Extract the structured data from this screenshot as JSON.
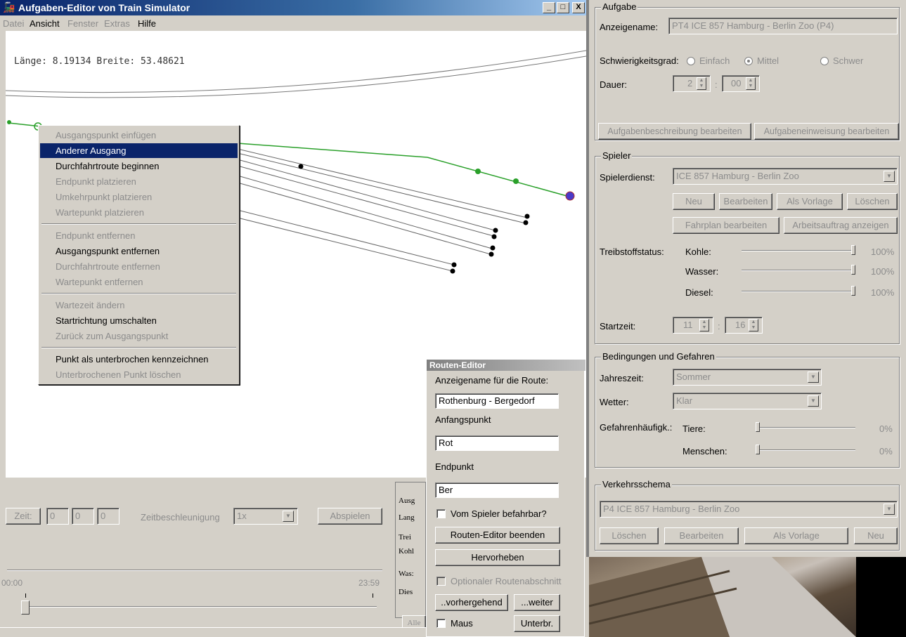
{
  "window": {
    "title": "Aufgaben-Editor von Train Simulator",
    "min": "_",
    "max": "□",
    "close": "X"
  },
  "menu": {
    "items": [
      {
        "label": "Datei",
        "enabled": false
      },
      {
        "label": "Ansicht",
        "enabled": true
      },
      {
        "label": "Fenster",
        "enabled": false
      },
      {
        "label": "Extras",
        "enabled": false
      },
      {
        "label": "Hilfe",
        "enabled": true
      }
    ]
  },
  "map": {
    "coords": "Länge: 8.19134 Breite: 53.48621"
  },
  "context_menu": {
    "items": [
      {
        "label": "Ausgangspunkt einfügen",
        "enabled": false
      },
      {
        "label": "Anderer Ausgang",
        "enabled": true,
        "selected": true
      },
      {
        "label": "Durchfahrtroute beginnen",
        "enabled": true
      },
      {
        "label": "Endpunkt platzieren",
        "enabled": false
      },
      {
        "label": "Umkehrpunkt platzieren",
        "enabled": false
      },
      {
        "label": "Wartepunkt platzieren",
        "enabled": false
      },
      {
        "label": "Endpunkt entfernen",
        "enabled": false
      },
      {
        "label": "Ausgangspunkt entfernen",
        "enabled": true
      },
      {
        "label": "Durchfahrtroute entfernen",
        "enabled": false
      },
      {
        "label": "Wartepunkt entfernen",
        "enabled": false
      },
      {
        "label": "Wartezeit ändern",
        "enabled": false
      },
      {
        "label": "Startrichtung umschalten",
        "enabled": true
      },
      {
        "label": "Zurück zum Ausgangspunkt",
        "enabled": false
      },
      {
        "label": "Punkt als unterbrochen kennzeichnen",
        "enabled": true
      },
      {
        "label": "Unterbrochenen Punkt löschen",
        "enabled": false
      }
    ]
  },
  "time_panel": {
    "zeit_button": "Zeit:",
    "h": "0",
    "m": "0",
    "s": "0",
    "accel_label": "Zeitbeschleunigung",
    "accel_value": "1x",
    "play_button": "Abspielen",
    "start": "00:00",
    "end": "23:59",
    "slider_value": 0
  },
  "mini_panel": {
    "rows": [
      "Ausg",
      "Lang",
      "Trei",
      "Kohl",
      "Was:",
      "Dies"
    ],
    "button": "Alle"
  },
  "route_editor": {
    "title": "Routen-Editor",
    "name_label": "Anzeigename für die Route:",
    "name_value": "Rothenburg - Bergedorf",
    "start_label": "Anfangspunkt",
    "start_value": "Rot",
    "end_label": "Endpunkt",
    "end_value": "Ber",
    "player_check": "Vom Spieler befahrbar?",
    "close_button": "Routen-Editor beenden",
    "highlight_button": "Hervorheben",
    "optional_check": "Optionaler Routenabschnitt",
    "prev_button": "..vorhergehend",
    "next_button": "...weiter",
    "mouse_check": "Maus",
    "break_button": "Unterbr."
  },
  "aufgabe": {
    "group": "Aufgabe",
    "name_label": "Anzeigename:",
    "name_value": "PT4 ICE 857 Hamburg - Berlin Zoo (P4)",
    "difficulty_label": "Schwierigkeitsgrad:",
    "easy": "Einfach",
    "medium": "Mittel",
    "hard": "Schwer",
    "duration_label": "Dauer:",
    "duration_h": "2",
    "duration_m": "00",
    "colon": ":",
    "desc_button": "Aufgabenbeschreibung bearbeiten",
    "brief_button": "Aufgabeneinweisung bearbeiten"
  },
  "spieler": {
    "group": "Spieler",
    "service_label": "Spielerdienst:",
    "service_value": "ICE 857 Hamburg - Berlin Zoo",
    "new": "Neu",
    "edit": "Bearbeiten",
    "template": "Als Vorlage",
    "delete": "Löschen",
    "timetable": "Fahrplan bearbeiten",
    "work": "Arbeitsauftrag anzeigen",
    "fuel_label": "Treibstoffstatus:",
    "fuel": [
      {
        "name": "Kohle:",
        "value": "100%",
        "level": 1.0
      },
      {
        "name": "Wasser:",
        "value": "100%",
        "level": 1.0
      },
      {
        "name": "Diesel:",
        "value": "100%",
        "level": 1.0
      }
    ],
    "start_label": "Startzeit:",
    "start_h": "11",
    "start_m": "16",
    "colon": ":"
  },
  "bedingungen": {
    "group": "Bedingungen und Gefahren",
    "season_label": "Jahreszeit:",
    "season_value": "Sommer",
    "weather_label": "Wetter:",
    "weather_value": "Klar",
    "hazard_label": "Gefahrenhäufigk.:",
    "hazards": [
      {
        "name": "Tiere:",
        "value": "0%",
        "level": 0
      },
      {
        "name": "Menschen:",
        "value": "0%",
        "level": 0
      }
    ]
  },
  "verkehr": {
    "group": "Verkehrsschema",
    "value": "P4 ICE 857 Hamburg - Berlin Zoo",
    "delete": "Löschen",
    "edit": "Bearbeiten",
    "template": "Als Vorlage",
    "new": "Neu"
  },
  "colors": {
    "selection": "#0a246a",
    "path_green": "#2aa02a",
    "endpoint": "#4a3ac8"
  }
}
